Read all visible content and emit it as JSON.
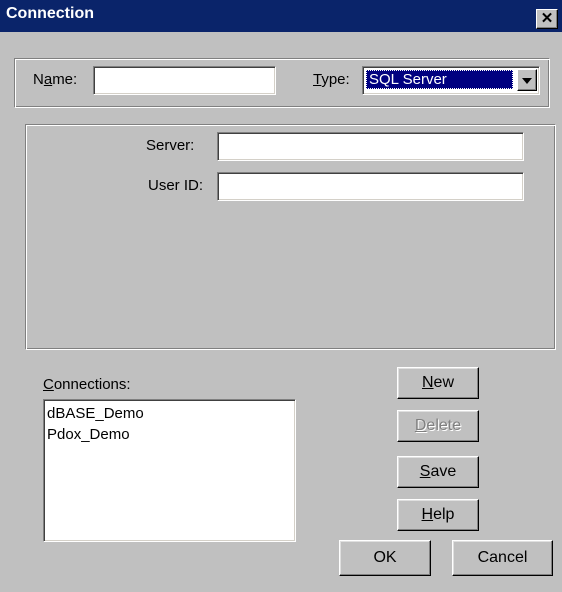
{
  "window": {
    "title": "Connection",
    "close_glyph": "✕"
  },
  "top_group": {
    "name_label_pre": "N",
    "name_label_accel": "a",
    "name_label_post": "me:",
    "name_value": "",
    "type_label_accel": "T",
    "type_label_post": "ype:",
    "type_selected": "SQL Server"
  },
  "settings": {
    "server_label": "Server:",
    "server_value": "",
    "userid_label": "User ID:",
    "userid_value": ""
  },
  "connections": {
    "label_accel": "C",
    "label_post": "onnections:",
    "items": [
      "dBASE_Demo",
      "Pdox_Demo"
    ]
  },
  "buttons": {
    "new_accel": "N",
    "new_post": "ew",
    "delete_accel": "D",
    "delete_post": "elete",
    "save_accel": "S",
    "save_post": "ave",
    "help_accel": "H",
    "help_post": "elp",
    "ok": "OK",
    "cancel": "Cancel"
  },
  "colors": {
    "title_bar": "#0a246a",
    "face": "#c0c0c0",
    "selection": "#000080"
  }
}
